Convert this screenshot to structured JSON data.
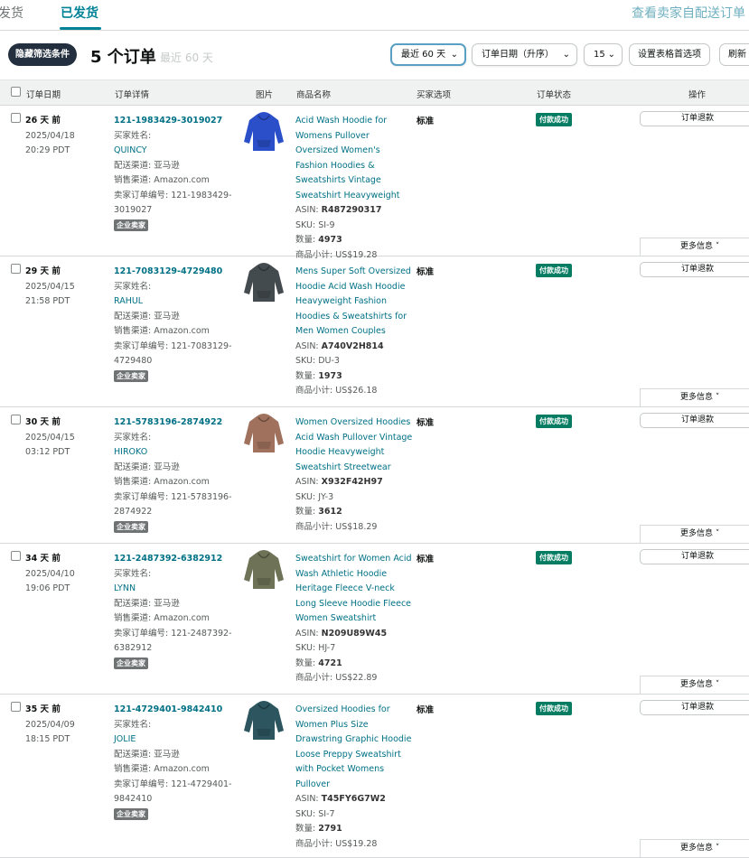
{
  "tabs": {
    "unshipped_label": "未发货",
    "shipped_label": "已发货",
    "right_link": "查看卖家自配送订单"
  },
  "toolbar": {
    "hide_filters_label": "隐藏筛选条件",
    "order_count_label": "5 个订单",
    "range_label": "最近 60 天",
    "range_select": "最近 60 天",
    "sort_select": "订单日期（升序）",
    "per_page_select": "15",
    "prefs_button": "设置表格首选项",
    "refresh_button": "刷新"
  },
  "table_headers": {
    "date": "订单日期",
    "detail": "订单详情",
    "image": "图片",
    "product": "商品名称",
    "option": "买家选项",
    "status": "订单状态",
    "action": "操作"
  },
  "labels": {
    "buyer_name": "买家姓名:",
    "channel": "配送渠道: 亚马逊",
    "sales_channel": "销售渠道: Amazon.com",
    "seller_order_prefix": "卖家订单编号: ",
    "business_badge": "企业卖家",
    "asin_prefix": "ASIN: ",
    "sku_prefix": "SKU: ",
    "qty_prefix": "数量: ",
    "subtotal_prefix": "商品小计: ",
    "refund_button": "订单退款",
    "more_info": "更多信息"
  },
  "orders": [
    {
      "ago": "26 天 前",
      "date": "2025/04/18",
      "time": "20:29 PDT",
      "order_id": "121-1983429-3019027",
      "buyer": "QUINCY",
      "seller_order_1": "卖家订单编号: 121-1983429-",
      "seller_order_2": "3019027",
      "title": "Acid Wash Hoodie for Womens Pullover Oversized Women's Fashion Hoodies & Sweatshirts Vintage Sweatshirt Heavyweight",
      "asin": "R487290317",
      "sku": "SI-9",
      "qty": "4973",
      "subtotal": "US$19.28",
      "option": "标准",
      "status": "付款成功",
      "image_color": "#2a4fc9"
    },
    {
      "ago": "29 天 前",
      "date": "2025/04/15",
      "time": "21:58 PDT",
      "order_id": "121-7083129-4729480",
      "buyer": "RAHUL",
      "seller_order_1": "卖家订单编号: 121-7083129-",
      "seller_order_2": "4729480",
      "title": "Mens Super Soft Oversized Hoodie Acid Wash Hoodie Heavyweight Fashion Hoodies & Sweatshirts for Men Women Couples",
      "asin": "A740V2H814",
      "sku": "DU-3",
      "qty": "1973",
      "subtotal": "US$26.18",
      "option": "标准",
      "status": "付款成功",
      "image_color": "#444b4f"
    },
    {
      "ago": "30 天 前",
      "date": "2025/04/15",
      "time": "03:12 PDT",
      "order_id": "121-5783196-2874922",
      "buyer": "HIROKO",
      "seller_order_1": "卖家订单编号: 121-5783196-",
      "seller_order_2": "2874922",
      "title": "Women Oversized Hoodies Acid Wash Pullover Vintage Hoodie Heavyweight Sweatshirt Streetwear",
      "asin": "X932F42H97",
      "sku": "JY-3",
      "qty": "3612",
      "subtotal": "US$18.29",
      "option": "标准",
      "status": "付款成功",
      "image_color": "#a0725e"
    },
    {
      "ago": "34 天 前",
      "date": "2025/04/10",
      "time": "19:06 PDT",
      "order_id": "121-2487392-6382912",
      "buyer": "LYNN",
      "seller_order_1": "卖家订单编号: 121-2487392-",
      "seller_order_2": "6382912",
      "title": "Sweatshirt for Women Acid Wash Athletic Hoodie Heritage Fleece V-neck Long Sleeve Hoodie Fleece Women Sweatshirt",
      "asin": "N209U89W45",
      "sku": "HJ-7",
      "qty": "4721",
      "subtotal": "US$22.89",
      "option": "标准",
      "status": "付款成功",
      "image_color": "#6e7357"
    },
    {
      "ago": "35 天 前",
      "date": "2025/04/09",
      "time": "18:15 PDT",
      "order_id": "121-4729401-9842410",
      "buyer": "JOLIE",
      "seller_order_1": "卖家订单编号: 121-4729401-",
      "seller_order_2": "9842410",
      "title": "Oversized Hoodies for Women Plus Size Drawstring Graphic Hoodie Loose Preppy Sweatshirt with Pocket Womens Pullover",
      "asin": "T45FY6G7W2",
      "sku": "SI-7",
      "qty": "2791",
      "subtotal": "US$19.28",
      "option": "标准",
      "status": "付款成功",
      "image_color": "#2c5560"
    }
  ]
}
